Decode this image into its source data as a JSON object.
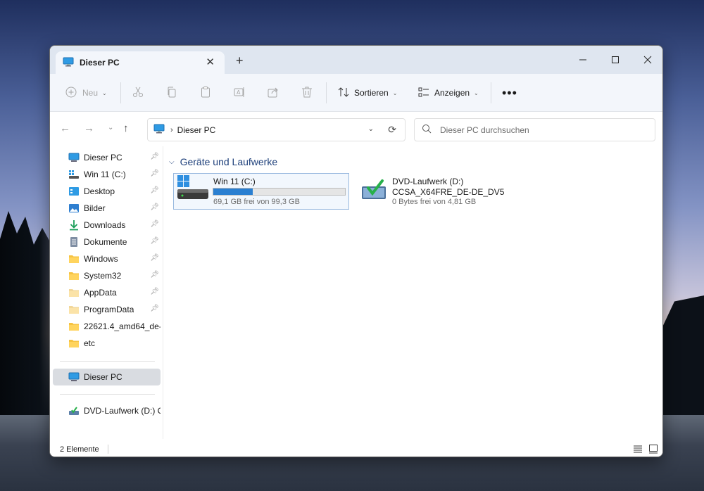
{
  "window": {
    "tab_title": "Dieser PC"
  },
  "toolbar": {
    "new_label": "Neu",
    "sort_label": "Sortieren",
    "view_label": "Anzeigen"
  },
  "address": {
    "path": "Dieser PC",
    "search_placeholder": "Dieser PC durchsuchen"
  },
  "sidebar": {
    "items": [
      {
        "label": "Dieser PC",
        "icon": "monitor-icon",
        "pinned": true
      },
      {
        "label": "Win 11 (C:)",
        "icon": "drive-icon",
        "pinned": true
      },
      {
        "label": "Desktop",
        "icon": "desktop-icon",
        "pinned": true
      },
      {
        "label": "Bilder",
        "icon": "pictures-icon",
        "pinned": true
      },
      {
        "label": "Downloads",
        "icon": "download-icon",
        "pinned": true
      },
      {
        "label": "Dokumente",
        "icon": "document-icon",
        "pinned": true
      },
      {
        "label": "Windows",
        "icon": "folder-icon",
        "pinned": true
      },
      {
        "label": "System32",
        "icon": "folder-icon",
        "pinned": true
      },
      {
        "label": "AppData",
        "icon": "folder-icon",
        "pinned": true
      },
      {
        "label": "ProgramData",
        "icon": "folder-icon",
        "pinned": true
      },
      {
        "label": "22621.4_amd64_de-d",
        "icon": "folder-icon",
        "pinned": false
      },
      {
        "label": "etc",
        "icon": "folder-icon",
        "pinned": false
      }
    ],
    "this_pc": "Dieser PC",
    "dvd": "DVD-Laufwerk (D:) C"
  },
  "content": {
    "group_title": "Geräte und Laufwerke",
    "drives": [
      {
        "name": "Win 11 (C:)",
        "free_text": "69,1 GB frei von 99,3 GB",
        "used_fraction": 0.3
      },
      {
        "name": "DVD-Laufwerk (D:)",
        "label": "CCSA_X64FRE_DE-DE_DV5",
        "free_text": "0 Bytes frei von 4,81 GB"
      }
    ]
  },
  "status": {
    "count_text": "2 Elemente"
  },
  "colors": {
    "accent": "#2a7fd1",
    "folder": "#f6c342",
    "group_header": "#1d3f7a"
  }
}
